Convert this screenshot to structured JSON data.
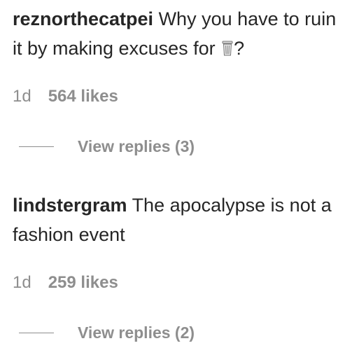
{
  "comments": [
    {
      "username": "reznorthecatpei",
      "text_before_icon": "Why you have to ruin it by making excuses for",
      "icon": "trash-can-icon",
      "text_after_icon": "?",
      "time": "1d",
      "likes": "564 likes",
      "view_replies": "View replies (3)"
    },
    {
      "username": "lindstergram",
      "text": "The apocalypse is not a fashion event",
      "time": "1d",
      "likes": "259 likes",
      "view_replies": "View replies (2)"
    }
  ],
  "colors": {
    "primary_text": "#262626",
    "secondary_text": "#8e8e8e",
    "background": "#ffffff"
  }
}
